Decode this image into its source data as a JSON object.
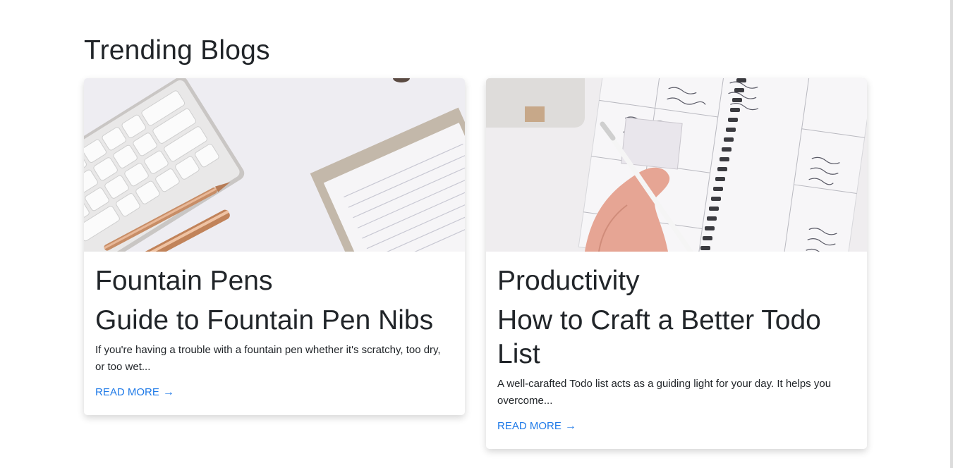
{
  "page": {
    "title": "Trending Blogs"
  },
  "cards": [
    {
      "category": "Fountain Pens",
      "title": "Guide to Fountain Pen Nibs",
      "excerpt": "If you're having a trouble with a fountain pen whether it's scratchy, too dry, or too wet...",
      "read_more": "READ MORE",
      "arrow_icon": "arrow-right-icon",
      "image_subject": "keyboard-pens-notepad"
    },
    {
      "category": "Productivity",
      "title": "How to Craft a Better Todo List",
      "excerpt": "A well-carafted Todo list acts as a guiding light for your day. It helps you overcome...",
      "read_more": "READ MORE",
      "arrow_icon": "arrow-right-icon",
      "image_subject": "planner-writing"
    }
  ],
  "colors": {
    "link": "#1f7ae8",
    "text": "#212529"
  }
}
